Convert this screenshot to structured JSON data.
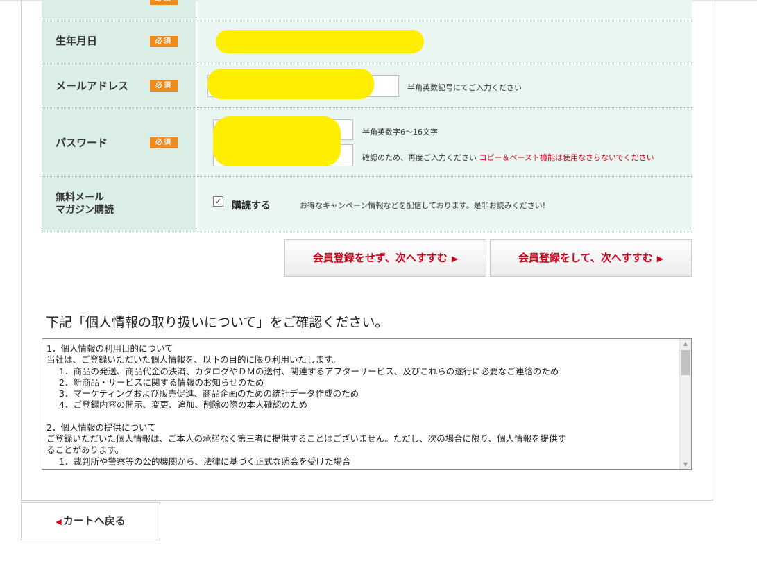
{
  "colors": {
    "accent_red": "#d0021b",
    "required_badge": "#f08a1b",
    "label_bg": "#dbeee6",
    "value_bg": "#eaf6f1",
    "redaction": "#ffee00"
  },
  "form": {
    "required_label": "必須",
    "birthdate": {
      "label": "生年月日"
    },
    "email": {
      "label": "メールアドレス",
      "hint": "半角英数記号にてご入力ください"
    },
    "password": {
      "label": "パスワード",
      "hint1": "半角英数字6～16文字",
      "hint2": "確認のため、再度ご入力ください",
      "warning": "コピー＆ペースト機能は使用なさらないでください"
    },
    "newsletter": {
      "label": "無料メール\nマガジン購読",
      "checkbox_label": "購読する",
      "checked": true,
      "checkmark": "✓",
      "hint": "お得なキャンペーン情報などを配信しております。是非お読みください!"
    }
  },
  "buttons": {
    "guest_next": "会員登録をせず、次へすすむ",
    "register_next": "会員登録をして、次へすすむ",
    "arrow": "▶",
    "back_arrow": "◀",
    "back_to_cart": "カートへ戻る"
  },
  "privacy": {
    "title": "下記「個人情報の取り扱いについて」をご確認ください。",
    "lines": [
      {
        "text": "1．個人情報の利用目的について",
        "indent": false
      },
      {
        "text": "当社は、ご登録いただいた個人情報を、以下の目的に限り利用いたします。",
        "indent": false
      },
      {
        "text": "1．商品の発送、商品代金の決済、カタログやＤＭの送付、関連するアフターサービス、及びこれらの遂行に必要なご連絡のため",
        "indent": true
      },
      {
        "text": "2．新商品・サービスに関する情報のお知らせのため",
        "indent": true
      },
      {
        "text": "3．マーケティングおよび販売促進、商品企画のための統計データ作成のため",
        "indent": true
      },
      {
        "text": "4．ご登録内容の開示、変更、追加、削除の際の本人確認のため",
        "indent": true
      },
      {
        "text": "",
        "indent": false
      },
      {
        "text": "2．個人情報の提供について",
        "indent": false
      },
      {
        "text": "ご登録いただいた個人情報は、ご本人の承諾なく第三者に提供することはございません。ただし、次の場合に限り、個人情報を提供す",
        "indent": false
      },
      {
        "text": "ることがあります。",
        "indent": false
      },
      {
        "text": "1．裁判所や警察等の公的機関から、法律に基づく正式な照会を受けた場合",
        "indent": true
      }
    ],
    "scroll_up": "▲",
    "scroll_down": "▼"
  }
}
